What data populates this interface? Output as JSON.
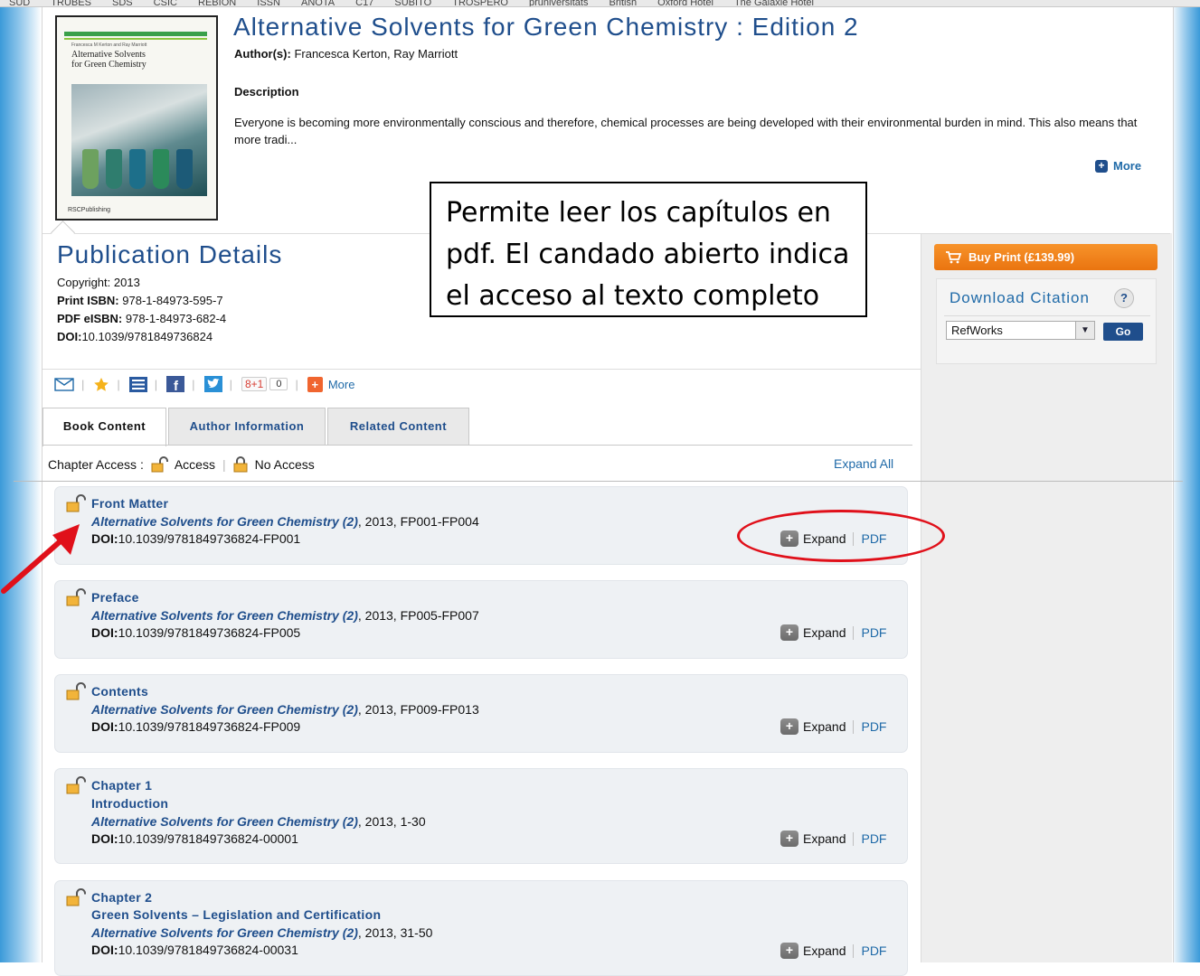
{
  "bookmarks": [
    "SUD",
    "TRUBES",
    "SDS",
    "CSIC",
    "REBION",
    "ISSN",
    "ANOTA",
    "C17",
    "SUBITO",
    "TROSPERO",
    "pruniversitats",
    "British",
    "Oxford Hotel",
    "The Galaxie Hotel"
  ],
  "book": {
    "title": "Alternative Solvents for Green Chemistry : Edition 2",
    "authors_label": "Author(s):",
    "authors": "Francesca Kerton, Ray Marriott",
    "description_heading": "Description",
    "description": "Everyone is becoming more environmentally conscious and therefore, chemical processes are being developed with their environmental burden in mind. This also means that more tradi...",
    "more_label": "More",
    "cover": {
      "title_line1": "Alternative Solvents",
      "title_line2": "for Green Chemistry",
      "authors": "Francesca M Kerton and Ray Marriott",
      "publisher": "RSCPublishing"
    }
  },
  "publication": {
    "heading": "Publication Details",
    "copyright_label": "Copyright:",
    "copyright": "2013",
    "print_isbn_label": "Print ISBN:",
    "print_isbn": "978-1-84973-595-7",
    "pdf_isbn_label": "PDF eISBN:",
    "pdf_isbn": "978-1-84973-682-4",
    "doi_label": "DOI:",
    "doi": "10.1039/9781849736824"
  },
  "annotation": {
    "text": "Permite leer los capítulos en pdf. El candado abierto indica el acceso al texto completo"
  },
  "sidebar": {
    "buy_label": "Buy Print (£139.99)",
    "citation_heading": "Download Citation",
    "help_label": "?",
    "format_selected": "RefWorks",
    "go_label": "Go"
  },
  "share": {
    "gplus_label": "8+1",
    "gplus_count": "0",
    "more_label": "More"
  },
  "tabs": [
    {
      "label": "Book Content",
      "active": true
    },
    {
      "label": "Author Information",
      "active": false
    },
    {
      "label": "Related Content",
      "active": false
    }
  ],
  "access": {
    "label": "Chapter Access :",
    "access_label": "Access",
    "no_access_label": "No Access",
    "expand_all": "Expand All"
  },
  "chapters": [
    {
      "title": "Front Matter",
      "subtitle": "",
      "source": "Alternative Solvents for Green Chemistry (2)",
      "details": ", 2013, FP001-FP004",
      "doi": "10.1039/9781849736824-FP001"
    },
    {
      "title": "Preface",
      "subtitle": "",
      "source": "Alternative Solvents for Green Chemistry (2)",
      "details": ", 2013, FP005-FP007",
      "doi": "10.1039/9781849736824-FP005"
    },
    {
      "title": "Contents",
      "subtitle": "",
      "source": "Alternative Solvents for Green Chemistry (2)",
      "details": ", 2013, FP009-FP013",
      "doi": "10.1039/9781849736824-FP009"
    },
    {
      "title": "Chapter 1",
      "subtitle": "Introduction",
      "source": "Alternative Solvents for Green Chemistry (2)",
      "details": ", 2013, 1-30",
      "doi": "10.1039/9781849736824-00001"
    },
    {
      "title": "Chapter 2",
      "subtitle": "Green Solvents – Legislation and Certification",
      "source": "Alternative Solvents for Green Chemistry (2)",
      "details": ", 2013, 31-50",
      "doi": "10.1039/9781849736824-00031"
    }
  ],
  "chapter_actions": {
    "doi_label": "DOI:",
    "expand_label": "Expand",
    "pdf_label": "PDF",
    "expand_icon": "+"
  },
  "colors": {
    "link_blue": "#1f4e8c",
    "buy_orange": "#ea7410",
    "highlight_red": "#e0101a"
  },
  "icons": [
    "mail-icon",
    "star-icon",
    "list-icon",
    "facebook-icon",
    "twitter-icon",
    "google-plus-icon",
    "add-icon",
    "open-lock-icon",
    "closed-lock-icon",
    "cart-icon"
  ]
}
